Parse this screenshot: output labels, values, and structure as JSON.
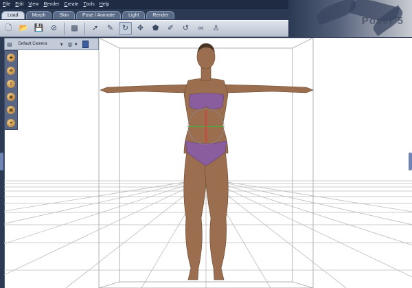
{
  "menu": {
    "items": [
      "File",
      "Edit",
      "View",
      "Render",
      "Create",
      "Tools",
      "Help"
    ]
  },
  "brand": {
    "text": "Poser 5"
  },
  "tabs": [
    {
      "label": "Load",
      "active": true
    },
    {
      "label": "Morph",
      "active": false
    },
    {
      "label": "Skin",
      "active": false
    },
    {
      "label": "Pose / Animate",
      "active": false
    },
    {
      "label": "Light",
      "active": false
    },
    {
      "label": "Render",
      "active": false
    }
  ],
  "toolbar": {
    "buttons": [
      {
        "name": "new-icon",
        "glyph": "🗋"
      },
      {
        "name": "open-icon",
        "glyph": "📂"
      },
      {
        "name": "save-icon",
        "glyph": "💾"
      },
      {
        "name": "stop-icon",
        "glyph": "⊘"
      },
      {
        "name": "scene-icon",
        "glyph": "▩"
      },
      {
        "name": "select-arrow-icon",
        "glyph": "➚"
      },
      {
        "name": "brush-icon",
        "glyph": "✎"
      },
      {
        "name": "rotate-icon",
        "glyph": "↻",
        "selected": true
      },
      {
        "name": "move-icon",
        "glyph": "✥"
      },
      {
        "name": "morph-icon",
        "glyph": "⬟"
      },
      {
        "name": "paint-icon",
        "glyph": "✐"
      },
      {
        "name": "twist-icon",
        "glyph": "↺"
      },
      {
        "name": "link-icon",
        "glyph": "∞"
      },
      {
        "name": "figure-icon",
        "glyph": "♙"
      }
    ]
  },
  "camera": {
    "label": "Default Camera"
  },
  "colors": {
    "skin": "#9a6e4e",
    "bikini": "#8a5d9e",
    "grid": "#b9b9b9",
    "green_axis": "#3cb43c",
    "red_axis": "#e03c3c"
  }
}
